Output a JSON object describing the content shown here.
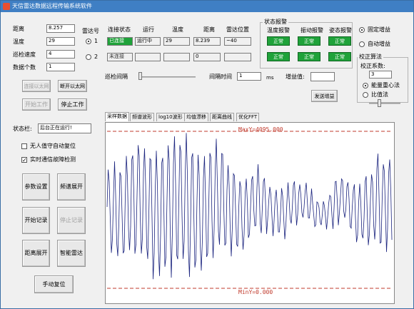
{
  "window": {
    "title": "天信雷达数据远程传输系统软件"
  },
  "left": {
    "distance": {
      "label": "距离",
      "value": "8.257"
    },
    "temperature": {
      "label": "温度",
      "value": "29"
    },
    "speed": {
      "label": "巡检速度",
      "value": "4"
    },
    "count": {
      "label": "数据个数",
      "value": "1"
    }
  },
  "radar": {
    "header_num": "雷达号",
    "header_state": "连接状态",
    "header_run": "运行",
    "header_temp": "温度",
    "header_dist": "距离",
    "header_pos": "雷达位置",
    "row1": {
      "num": "1",
      "state": "已连接",
      "run": "运行中",
      "temp": "29",
      "dist": "8.239",
      "pos": "~40"
    },
    "row2": {
      "num": "2",
      "state": "未连接",
      "run": "",
      "temp": "",
      "dist": "0",
      "pos": ""
    }
  },
  "alarm": {
    "title": "状态报警",
    "temp_label": "温度报警",
    "vib_label": "振动报警",
    "pose_label": "姿态报警",
    "ok": "正常"
  },
  "gain": {
    "fixed": "固定增益",
    "auto": "自动增益",
    "value_label": "增益值:",
    "send": "发送增益"
  },
  "calib": {
    "title": "校正算法",
    "coef_label": "校正系数:",
    "coef_value": "3",
    "energy": "能量重心法",
    "ratio": "比值法"
  },
  "scan": {
    "interval_label": "巡检间隔",
    "time_label": "间隔时间",
    "time_value": "1",
    "time_unit": "ms"
  },
  "buttons": {
    "connect": "连接以太网",
    "disconnect": "断开以太网",
    "start_work": "开始工作",
    "stop_work": "停止工作",
    "param": "参数设置",
    "spectrum": "频谱展开",
    "start_rec": "开始记录",
    "stop_rec": "停止记录",
    "dist_expand": "距离展开",
    "smart_radar": "智能雷达",
    "manual_reset": "手动复位"
  },
  "status": {
    "label": "状态栏:",
    "value": "后台正在运行!"
  },
  "checks": {
    "auto_reset": "无人值守自动复位",
    "realtime": "实时通信故障检测"
  },
  "tabs": [
    "采样数据",
    "频谱波形",
    "log10波形",
    "均值漂移",
    "距离曲线",
    "优化FFT"
  ],
  "chart_data": {
    "type": "line",
    "annotations": [
      "MaxY=4095.000",
      "MinY=0.000"
    ],
    "ylim": [
      0,
      4095
    ]
  },
  "colors": {
    "ok": "#1fa23a",
    "series": "#1a237e",
    "ref_line": "#c0392b"
  }
}
